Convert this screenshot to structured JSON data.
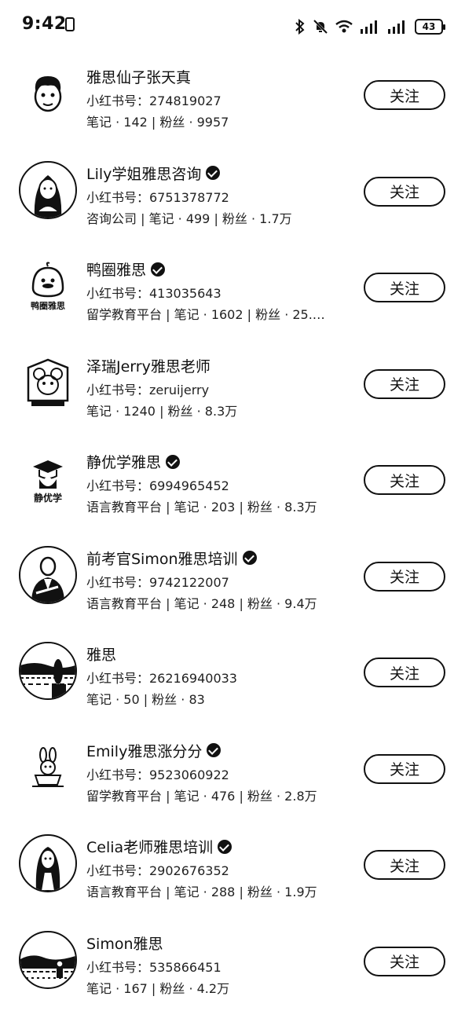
{
  "status_bar": {
    "time": "9:42",
    "battery": "43"
  },
  "accounts": [
    {
      "name": "雅思仙子张天真",
      "verified": false,
      "account": "小红书号：274819027",
      "stats": "笔记 · 142 | 粉丝 · 9957",
      "follow": "关注",
      "avatar": "boy-cartoon-icon"
    },
    {
      "name": "Lily学姐雅思咨询",
      "verified": true,
      "account": "小红书号：6751378772",
      "stats": "咨询公司 | 笔记 · 499 | 粉丝 · 1.7万",
      "follow": "关注",
      "avatar": "girl-portrait-icon"
    },
    {
      "name": "鸭圈雅思",
      "verified": true,
      "account": "小红书号：413035643",
      "stats": "留学教育平台 | 笔记 · 1602 | 粉丝 · 25.…",
      "follow": "关注",
      "avatar": "duck-logo-icon",
      "logo_text": "鸭圈雅思"
    },
    {
      "name": "泽瑞Jerry雅思老师",
      "verified": false,
      "account": "小红书号：zeruijerry",
      "stats": "笔记 · 1240 | 粉丝 · 8.3万",
      "follow": "关注",
      "avatar": "mouse-logo-icon"
    },
    {
      "name": "静优学雅思",
      "verified": true,
      "account": "小红书号：6994965452",
      "stats": "语言教育平台 | 笔记 · 203 | 粉丝 · 8.3万",
      "follow": "关注",
      "avatar": "graduate-logo-icon",
      "logo_text": "静优学"
    },
    {
      "name": "前考官Simon雅思培训",
      "verified": true,
      "account": "小红书号：9742122007",
      "stats": "语言教育平台 | 笔记 · 248 | 粉丝 · 9.4万",
      "follow": "关注",
      "avatar": "man-suit-icon"
    },
    {
      "name": "雅思",
      "verified": false,
      "account": "小红书号：26216940033",
      "stats": "笔记 · 50 | 粉丝 · 83",
      "follow": "关注",
      "avatar": "seaside-photo-icon"
    },
    {
      "name": "Emily雅思涨分分",
      "verified": true,
      "account": "小红书号：9523060922",
      "stats": "留学教育平台 | 笔记 · 476 | 粉丝 · 2.8万",
      "follow": "关注",
      "avatar": "bunny-cup-icon"
    },
    {
      "name": "Celia老师雅思培训",
      "verified": true,
      "account": "小红书号：2902676352",
      "stats": "语言教育平台 | 笔记 · 288 | 粉丝 · 1.9万",
      "follow": "关注",
      "avatar": "woman-portrait-icon"
    },
    {
      "name": "Simon雅思",
      "verified": false,
      "account": "小红书号：535866451",
      "stats": "笔记 · 167 | 粉丝 · 4.2万",
      "follow": "关注",
      "avatar": "landscape-photo-icon"
    }
  ]
}
